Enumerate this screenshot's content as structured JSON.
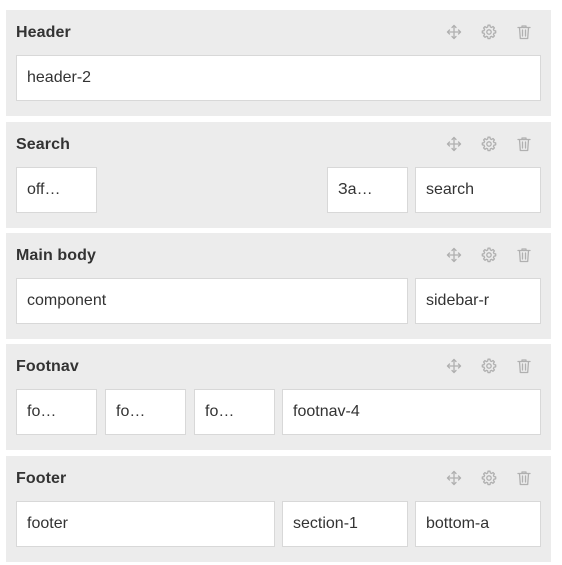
{
  "sections": [
    {
      "title": "Header",
      "blocks": [
        "header-2"
      ]
    },
    {
      "title": "Search",
      "blocks": [
        "off…",
        "За…",
        "search"
      ]
    },
    {
      "title": "Main body",
      "blocks": [
        "component",
        "sidebar-r"
      ]
    },
    {
      "title": "Footnav",
      "blocks": [
        "fo…",
        "fo…",
        "fo…",
        "footnav-4"
      ]
    },
    {
      "title": "Footer",
      "blocks": [
        "footer",
        "section-1",
        "bottom-a"
      ]
    }
  ],
  "icons": {
    "move": "move-icon",
    "settings": "gear-icon",
    "delete": "trash-icon"
  },
  "colors": {
    "section_bg": "#ececec",
    "block_bg": "#ffffff",
    "block_border": "#d8d8d8",
    "icon": "#b0b0b0",
    "text": "#333333"
  }
}
